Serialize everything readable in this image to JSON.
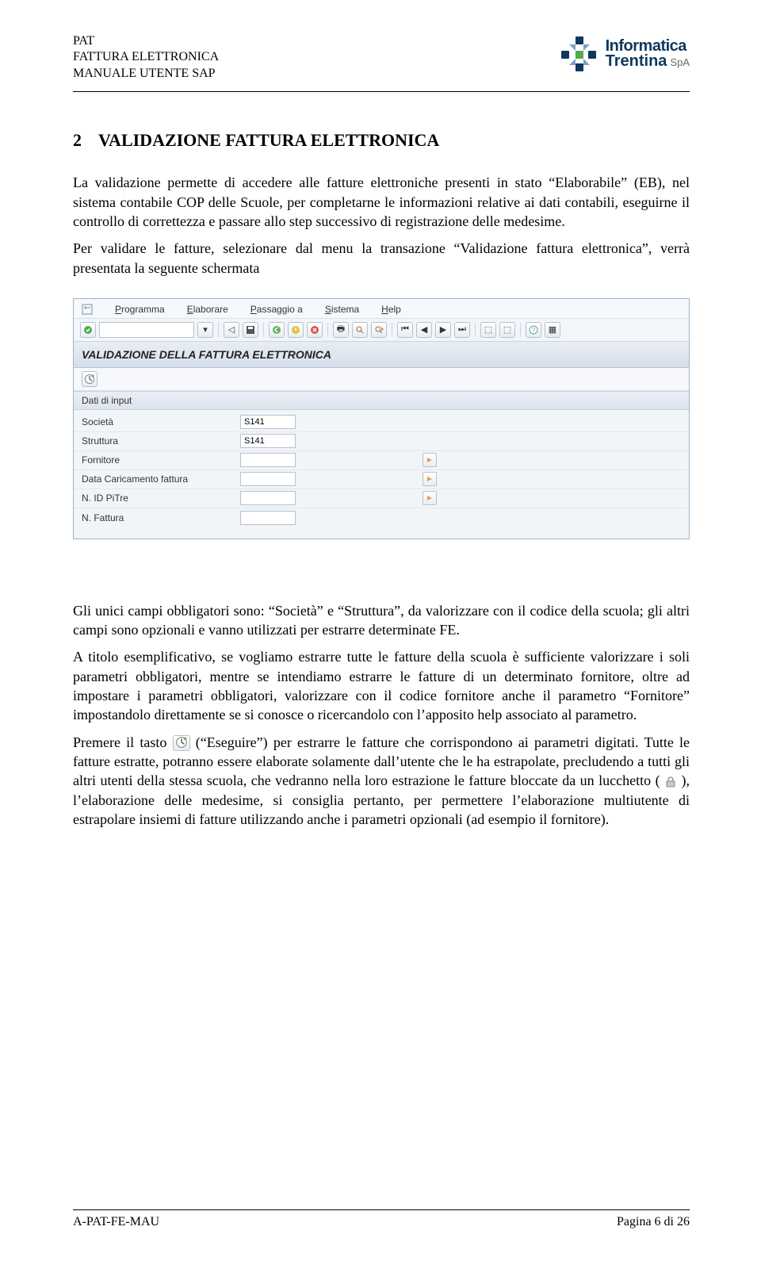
{
  "header": {
    "line1": "PAT",
    "line2": "FATTURA ELETTRONICA",
    "line3": "MANUALE UTENTE SAP",
    "logo_line1": "Informatica",
    "logo_line2": "Trentina",
    "logo_spa": "SpA"
  },
  "section": {
    "number": "2",
    "title": "VALIDAZIONE FATTURA ELETTRONICA"
  },
  "paragraphs": {
    "p1": "La validazione permette di accedere alle fatture elettroniche presenti in stato “Elaborabile” (EB), nel sistema contabile COP delle Scuole, per completarne le informazioni relative ai dati contabili, eseguirne il controllo di correttezza e passare allo step successivo di registrazione delle medesime.",
    "p2": "Per validare le fatture, selezionare dal menu la transazione “Validazione fattura elettronica”, verrà presentata la seguente schermata",
    "p3": "Gli unici campi obbligatori sono: “Società” e “Struttura”, da valorizzare con il codice della scuola; gli altri campi sono opzionali e vanno utilizzati per estrarre determinate FE.",
    "p4": "A titolo esemplificativo, se vogliamo estrarre tutte le fatture della scuola è sufficiente valorizzare i soli parametri obbligatori, mentre se intendiamo estrarre le fatture di un determinato fornitore, oltre ad impostare i parametri obbligatori, valorizzare con il codice fornitore anche il parametro “Fornitore” impostandolo direttamente se si conosce o ricercandolo con l’apposito help associato al parametro.",
    "p5a": "Premere il tasto ",
    "p5b": " (“Eseguire”) per estrarre le fatture che corrispondono ai parametri digitati. Tutte le fatture estratte, potranno essere elaborate solamente dall’utente che le ha estrapolate, precludendo a tutti gli altri utenti della stessa scuola, che vedranno nella loro estrazione le fatture bloccate da un lucchetto (",
    "p5c": "), l’elaborazione delle medesime, si consiglia pertanto, per permettere l’elaborazione multiutente di estrapolare insiemi di fatture utilizzando anche i parametri opzionali (ad esempio il fornitore)."
  },
  "sap": {
    "menus": [
      "Programma",
      "Elaborare",
      "Passaggio a",
      "Sistema",
      "Help"
    ],
    "title": "VALIDAZIONE DELLA FATTURA ELETTRONICA",
    "panel_header": "Dati di input",
    "fields": [
      {
        "label": "Società",
        "value": "S141",
        "lookup": false
      },
      {
        "label": "Struttura",
        "value": "S141",
        "lookup": false
      },
      {
        "label": "Fornitore",
        "value": "",
        "lookup": true
      },
      {
        "label": "Data Caricamento fattura",
        "value": "",
        "lookup": true
      },
      {
        "label": "N. ID PiTre",
        "value": "",
        "lookup": true
      },
      {
        "label": "N. Fattura",
        "value": "",
        "lookup": false
      }
    ]
  },
  "footer": {
    "left": "A-PAT-FE-MAU",
    "right": "Pagina 6 di 26"
  }
}
